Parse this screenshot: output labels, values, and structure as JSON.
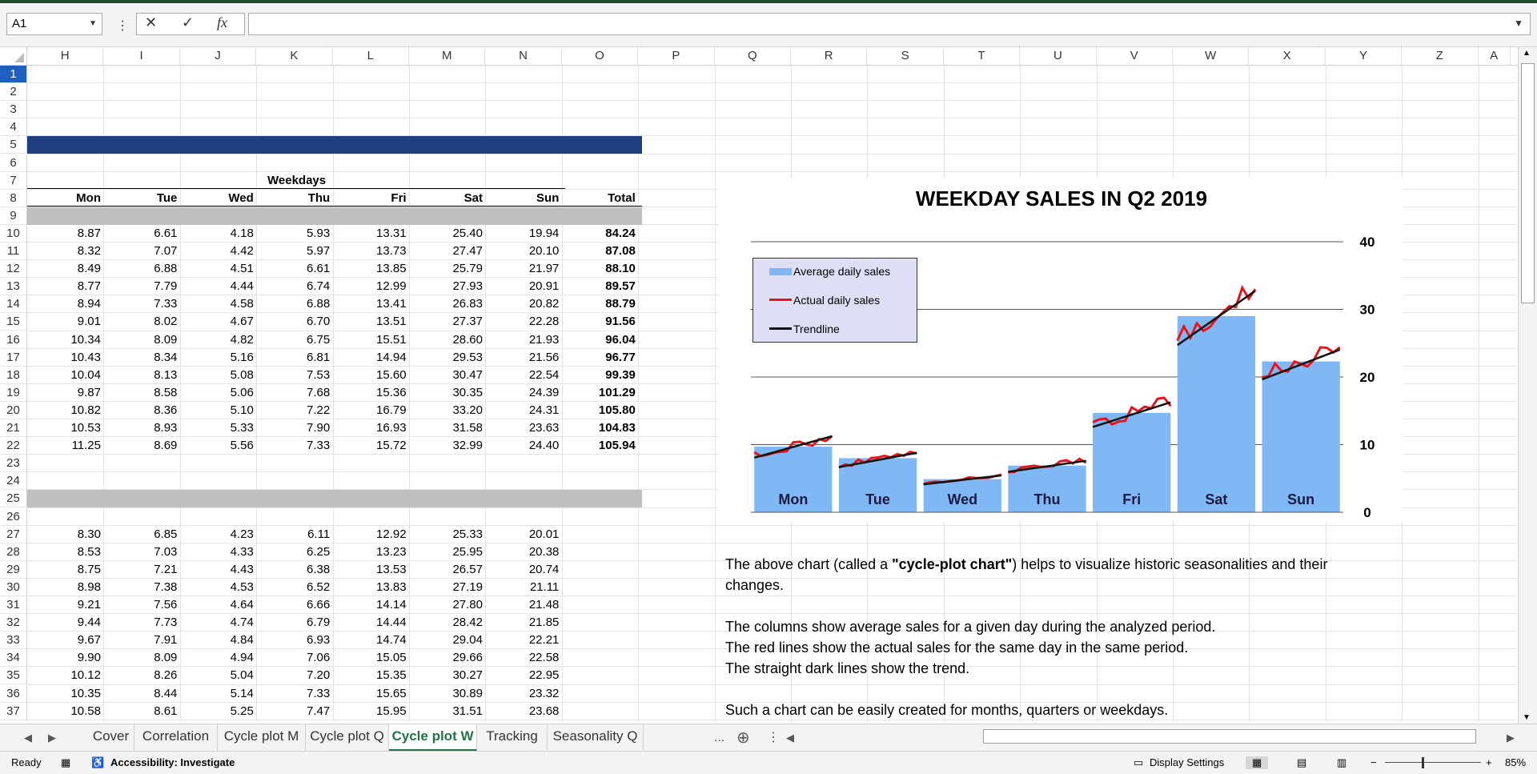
{
  "formula_bar": {
    "name_box": "A1",
    "cancel_icon": "✕",
    "enter_icon": "✓",
    "fx_label": "fx",
    "formula": ""
  },
  "columns": [
    "H",
    "I",
    "J",
    "K",
    "L",
    "M",
    "N",
    "O",
    "P",
    "Q",
    "R",
    "S",
    "T",
    "U",
    "V",
    "W",
    "X",
    "Y",
    "Z",
    "A"
  ],
  "rows": [
    "1",
    "2",
    "3",
    "4",
    "5",
    "6",
    "7",
    "8",
    "9",
    "10",
    "11",
    "12",
    "13",
    "14",
    "15",
    "16",
    "17",
    "18",
    "19",
    "20",
    "21",
    "22",
    "23",
    "24",
    "25",
    "26",
    "27",
    "28",
    "29",
    "30",
    "31",
    "32",
    "33",
    "34",
    "35",
    "36",
    "37"
  ],
  "table": {
    "group_title": "Weekdays",
    "headers": [
      "Mon",
      "Tue",
      "Wed",
      "Thu",
      "Fri",
      "Sat",
      "Sun",
      "Total"
    ],
    "block1": [
      [
        "8.87",
        "6.61",
        "4.18",
        "5.93",
        "13.31",
        "25.40",
        "19.94",
        "84.24"
      ],
      [
        "8.32",
        "7.07",
        "4.42",
        "5.97",
        "13.73",
        "27.47",
        "20.10",
        "87.08"
      ],
      [
        "8.49",
        "6.88",
        "4.51",
        "6.61",
        "13.85",
        "25.79",
        "21.97",
        "88.10"
      ],
      [
        "8.77",
        "7.79",
        "4.44",
        "6.74",
        "12.99",
        "27.93",
        "20.91",
        "89.57"
      ],
      [
        "8.94",
        "7.33",
        "4.58",
        "6.88",
        "13.41",
        "26.83",
        "20.82",
        "88.79"
      ],
      [
        "9.01",
        "8.02",
        "4.67",
        "6.70",
        "13.51",
        "27.37",
        "22.28",
        "91.56"
      ],
      [
        "10.34",
        "8.09",
        "4.82",
        "6.75",
        "15.51",
        "28.60",
        "21.93",
        "96.04"
      ],
      [
        "10.43",
        "8.34",
        "5.16",
        "6.81",
        "14.94",
        "29.53",
        "21.56",
        "96.77"
      ],
      [
        "10.04",
        "8.13",
        "5.08",
        "7.53",
        "15.60",
        "30.47",
        "22.54",
        "99.39"
      ],
      [
        "9.87",
        "8.58",
        "5.06",
        "7.68",
        "15.36",
        "30.35",
        "24.39",
        "101.29"
      ],
      [
        "10.82",
        "8.36",
        "5.10",
        "7.22",
        "16.79",
        "33.20",
        "24.31",
        "105.80"
      ],
      [
        "10.53",
        "8.93",
        "5.33",
        "7.90",
        "16.93",
        "31.58",
        "23.63",
        "104.83"
      ],
      [
        "11.25",
        "8.69",
        "5.56",
        "7.33",
        "15.72",
        "32.99",
        "24.40",
        "105.94"
      ]
    ],
    "block2": [
      [
        "8.30",
        "6.85",
        "4.23",
        "6.11",
        "12.92",
        "25.33",
        "20.01"
      ],
      [
        "8.53",
        "7.03",
        "4.33",
        "6.25",
        "13.23",
        "25.95",
        "20.38"
      ],
      [
        "8.75",
        "7.21",
        "4.43",
        "6.38",
        "13.53",
        "26.57",
        "20.74"
      ],
      [
        "8.98",
        "7.38",
        "4.53",
        "6.52",
        "13.83",
        "27.19",
        "21.11"
      ],
      [
        "9.21",
        "7.56",
        "4.64",
        "6.66",
        "14.14",
        "27.80",
        "21.48"
      ],
      [
        "9.44",
        "7.73",
        "4.74",
        "6.79",
        "14.44",
        "28.42",
        "21.85"
      ],
      [
        "9.67",
        "7.91",
        "4.84",
        "6.93",
        "14.74",
        "29.04",
        "22.21"
      ],
      [
        "9.90",
        "8.09",
        "4.94",
        "7.06",
        "15.05",
        "29.66",
        "22.58"
      ],
      [
        "10.12",
        "8.26",
        "5.04",
        "7.20",
        "15.35",
        "30.27",
        "22.95"
      ],
      [
        "10.35",
        "8.44",
        "5.14",
        "7.33",
        "15.65",
        "30.89",
        "23.32"
      ],
      [
        "10.58",
        "8.61",
        "5.25",
        "7.47",
        "15.95",
        "31.51",
        "23.68"
      ]
    ]
  },
  "chart_data": {
    "type": "bar",
    "title": "WEEKDAY SALES IN Q2 2019",
    "categories": [
      "Mon",
      "Tue",
      "Wed",
      "Thu",
      "Fri",
      "Sat",
      "Sun"
    ],
    "ylim": [
      0,
      40
    ],
    "yticks": [
      "0",
      "10",
      "20",
      "30",
      "40"
    ],
    "legend_position": "top-left",
    "colors": {
      "bar": "#7fb8f5",
      "actual": "#e8141c",
      "trend": "#111111"
    },
    "series": [
      {
        "name": "Average daily sales",
        "values": [
          9.7,
          8.0,
          4.9,
          6.9,
          14.7,
          29.0,
          22.3
        ]
      },
      {
        "name": "Actual daily sales",
        "values": [
          [
            8.87,
            8.32,
            8.49,
            8.77,
            8.94,
            9.01,
            10.34,
            10.43,
            10.04,
            9.87,
            10.82,
            10.53,
            11.25
          ],
          [
            6.61,
            7.07,
            6.88,
            7.79,
            7.33,
            8.02,
            8.09,
            8.34,
            8.13,
            8.58,
            8.36,
            8.93,
            8.69
          ],
          [
            4.18,
            4.42,
            4.51,
            4.44,
            4.58,
            4.67,
            4.82,
            5.16,
            5.08,
            5.06,
            5.1,
            5.33,
            5.56
          ],
          [
            5.93,
            5.97,
            6.61,
            6.74,
            6.88,
            6.7,
            6.75,
            6.81,
            7.53,
            7.68,
            7.22,
            7.9,
            7.33
          ],
          [
            13.31,
            13.73,
            13.85,
            12.99,
            13.41,
            13.51,
            15.51,
            14.94,
            15.6,
            15.36,
            16.79,
            16.93,
            15.72
          ],
          [
            25.4,
            27.47,
            25.79,
            27.93,
            26.83,
            27.37,
            28.6,
            29.53,
            30.47,
            30.35,
            33.2,
            31.58,
            32.99
          ],
          [
            19.94,
            20.1,
            21.97,
            20.91,
            20.82,
            22.28,
            21.93,
            21.56,
            22.54,
            24.39,
            24.31,
            23.63,
            24.4
          ]
        ]
      },
      {
        "name": "Trendline",
        "values": [
          [
            8.07,
            11.25
          ],
          [
            6.67,
            8.79
          ],
          [
            4.13,
            5.45
          ],
          [
            5.98,
            7.61
          ],
          [
            12.61,
            16.26
          ],
          [
            24.71,
            32.74
          ],
          [
            19.64,
            24.05
          ]
        ]
      }
    ]
  },
  "description": {
    "p1_pre": "The above chart (called a ",
    "p1_bold": "\"cycle-plot chart\"",
    "p1_post": ") helps to visualize historic seasonalities and their changes.",
    "p2": "The columns show average sales for a given day during the analyzed period.",
    "p3": "The red lines show the actual sales for the same day in the same period.",
    "p4": "The straight dark lines show the trend.",
    "p5": "Such a chart can be easily created for months, quarters or weekdays."
  },
  "tabs": [
    "Cover",
    "Correlation",
    "Cycle plot M",
    "Cycle plot Q",
    "Cycle plot W",
    "Tracking",
    "Seasonality Q"
  ],
  "active_tab": "Cycle plot W",
  "tab_more": "...",
  "status": {
    "ready": "Ready",
    "accessibility": "Accessibility: Investigate",
    "display_settings": "Display Settings",
    "zoom": "85%"
  }
}
